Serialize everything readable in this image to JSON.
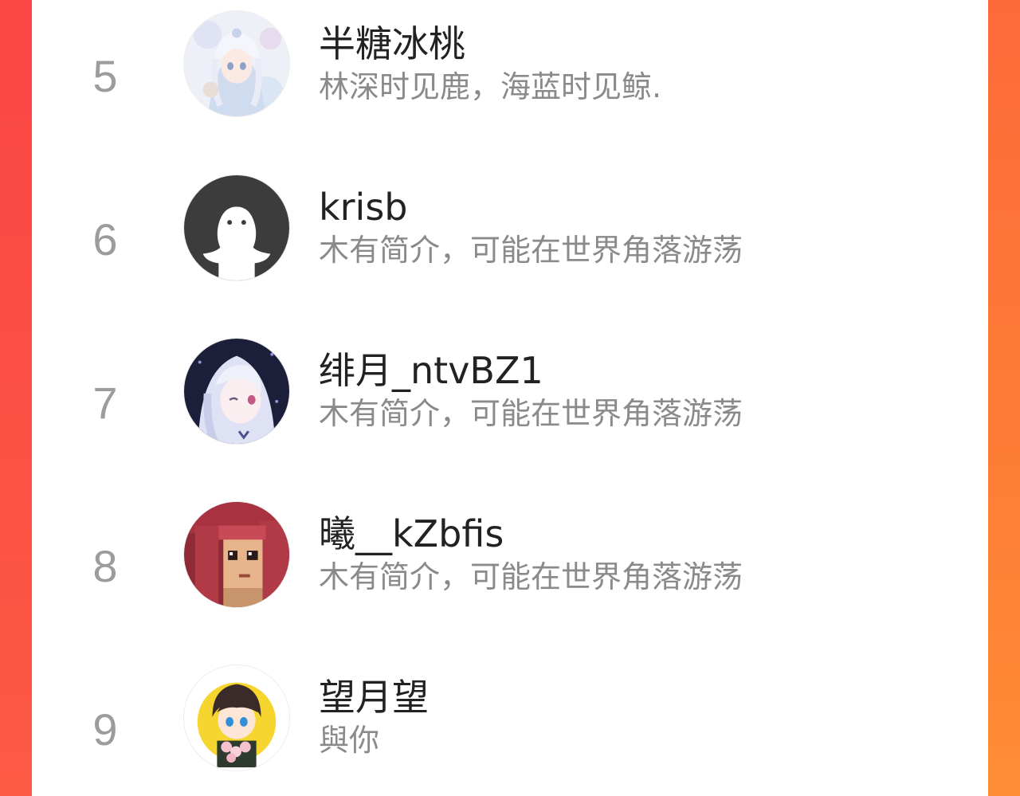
{
  "colors": {
    "left_edge": "#fc4f45",
    "right_edge": "#fe7c35",
    "rank_text": "#9c9c9c",
    "name_text": "#222222",
    "bio_text": "#8a8a8a"
  },
  "ranking": {
    "items": [
      {
        "rank": "5",
        "name": "半糖冰桃",
        "bio": "林深时见鹿，海蓝时见鲸.",
        "avatar": "anime-girl-white-hair-avatar"
      },
      {
        "rank": "6",
        "name": "krisb",
        "bio": "木有简介，可能在世界角落游荡",
        "avatar": "default-ghost-avatar"
      },
      {
        "rank": "7",
        "name": "绯月_ntvBZ1",
        "bio": "木有简介，可能在世界角落游荡",
        "avatar": "anime-silver-hair-avatar"
      },
      {
        "rank": "8",
        "name": "曦__kZbfis",
        "bio": "木有简介，可能在世界角落游荡",
        "avatar": "pixel-art-girl-avatar"
      },
      {
        "rank": "9",
        "name": "望月望",
        "bio": "與你",
        "avatar": "anime-boy-flowers-avatar"
      }
    ]
  }
}
